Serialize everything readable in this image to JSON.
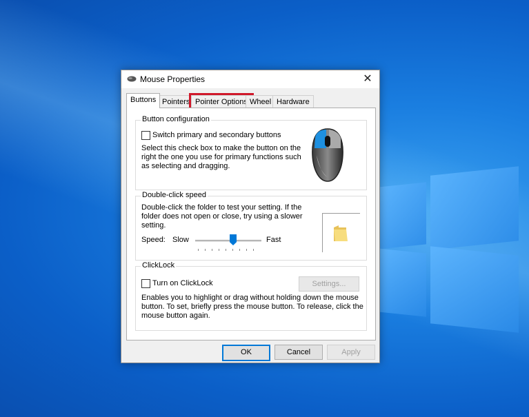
{
  "window": {
    "title": "Mouse Properties",
    "close_glyph": "✕"
  },
  "tabs": [
    {
      "label": "Buttons",
      "active": true
    },
    {
      "label": "Pointers"
    },
    {
      "label": "Pointer Options",
      "highlighted": true
    },
    {
      "label": "Wheel"
    },
    {
      "label": "Hardware"
    }
  ],
  "button_config": {
    "group_label": "Button configuration",
    "checkbox_label": "Switch primary and secondary buttons",
    "checked": false,
    "description_lines": [
      "Select this check box to make the button on the",
      "right the one you use for primary functions such",
      "as selecting and dragging."
    ],
    "mouse_icon": "mouse-icon"
  },
  "double_click": {
    "group_label": "Double-click speed",
    "description_lines": [
      "Double-click the folder to test your setting. If the",
      "folder does not open or close, try using a slower",
      "setting."
    ],
    "speed_label": "Speed:",
    "slow_label": "Slow",
    "fast_label": "Fast",
    "slider_value": 0.5,
    "folder_icon": "folder-icon"
  },
  "clicklock": {
    "group_label": "ClickLock",
    "checkbox_label": "Turn on ClickLock",
    "checked": false,
    "settings_button": "Settings...",
    "description_lines": [
      "Enables you to highlight or drag without holding down the mouse",
      "button. To set, briefly press the mouse button. To release, click the",
      "mouse button again."
    ]
  },
  "footer": {
    "ok": "OK",
    "cancel": "Cancel",
    "apply": "Apply"
  },
  "colors": {
    "highlight": "#d0182a",
    "accent": "#0078d7"
  }
}
